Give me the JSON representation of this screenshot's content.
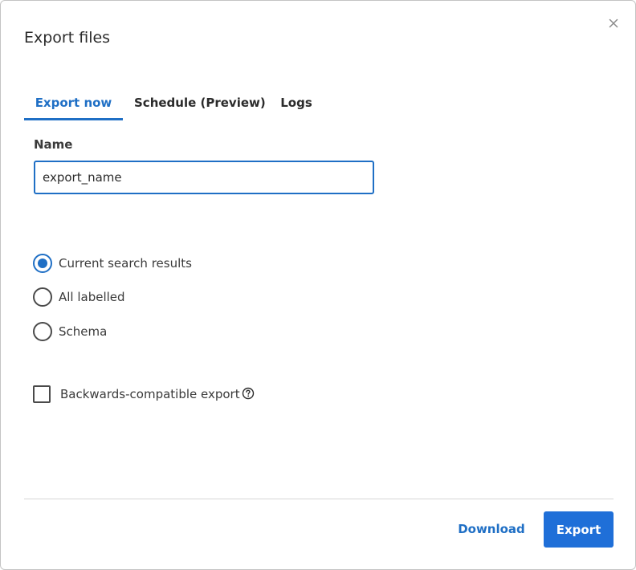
{
  "dialog": {
    "title": "Export files",
    "close_icon": "close-icon"
  },
  "tabs": [
    {
      "label": "Export now",
      "active": true
    },
    {
      "label": "Schedule (Preview)",
      "active": false
    },
    {
      "label": "Logs",
      "active": false
    }
  ],
  "form": {
    "name_label": "Name",
    "name_value": "export_name",
    "export_scope": {
      "selected": "Current search results",
      "options": [
        "Current search results",
        "All labelled",
        "Schema"
      ]
    },
    "backwards_compatible": {
      "label": "Backwards-compatible export",
      "checked": false,
      "help_icon": "question-circle-icon"
    }
  },
  "footer": {
    "download_label": "Download",
    "export_label": "Export"
  },
  "colors": {
    "accent": "#1f6fc5",
    "primary_button": "#1f6fd8",
    "text": "#2b2b2b",
    "border": "#c4c4c4"
  }
}
